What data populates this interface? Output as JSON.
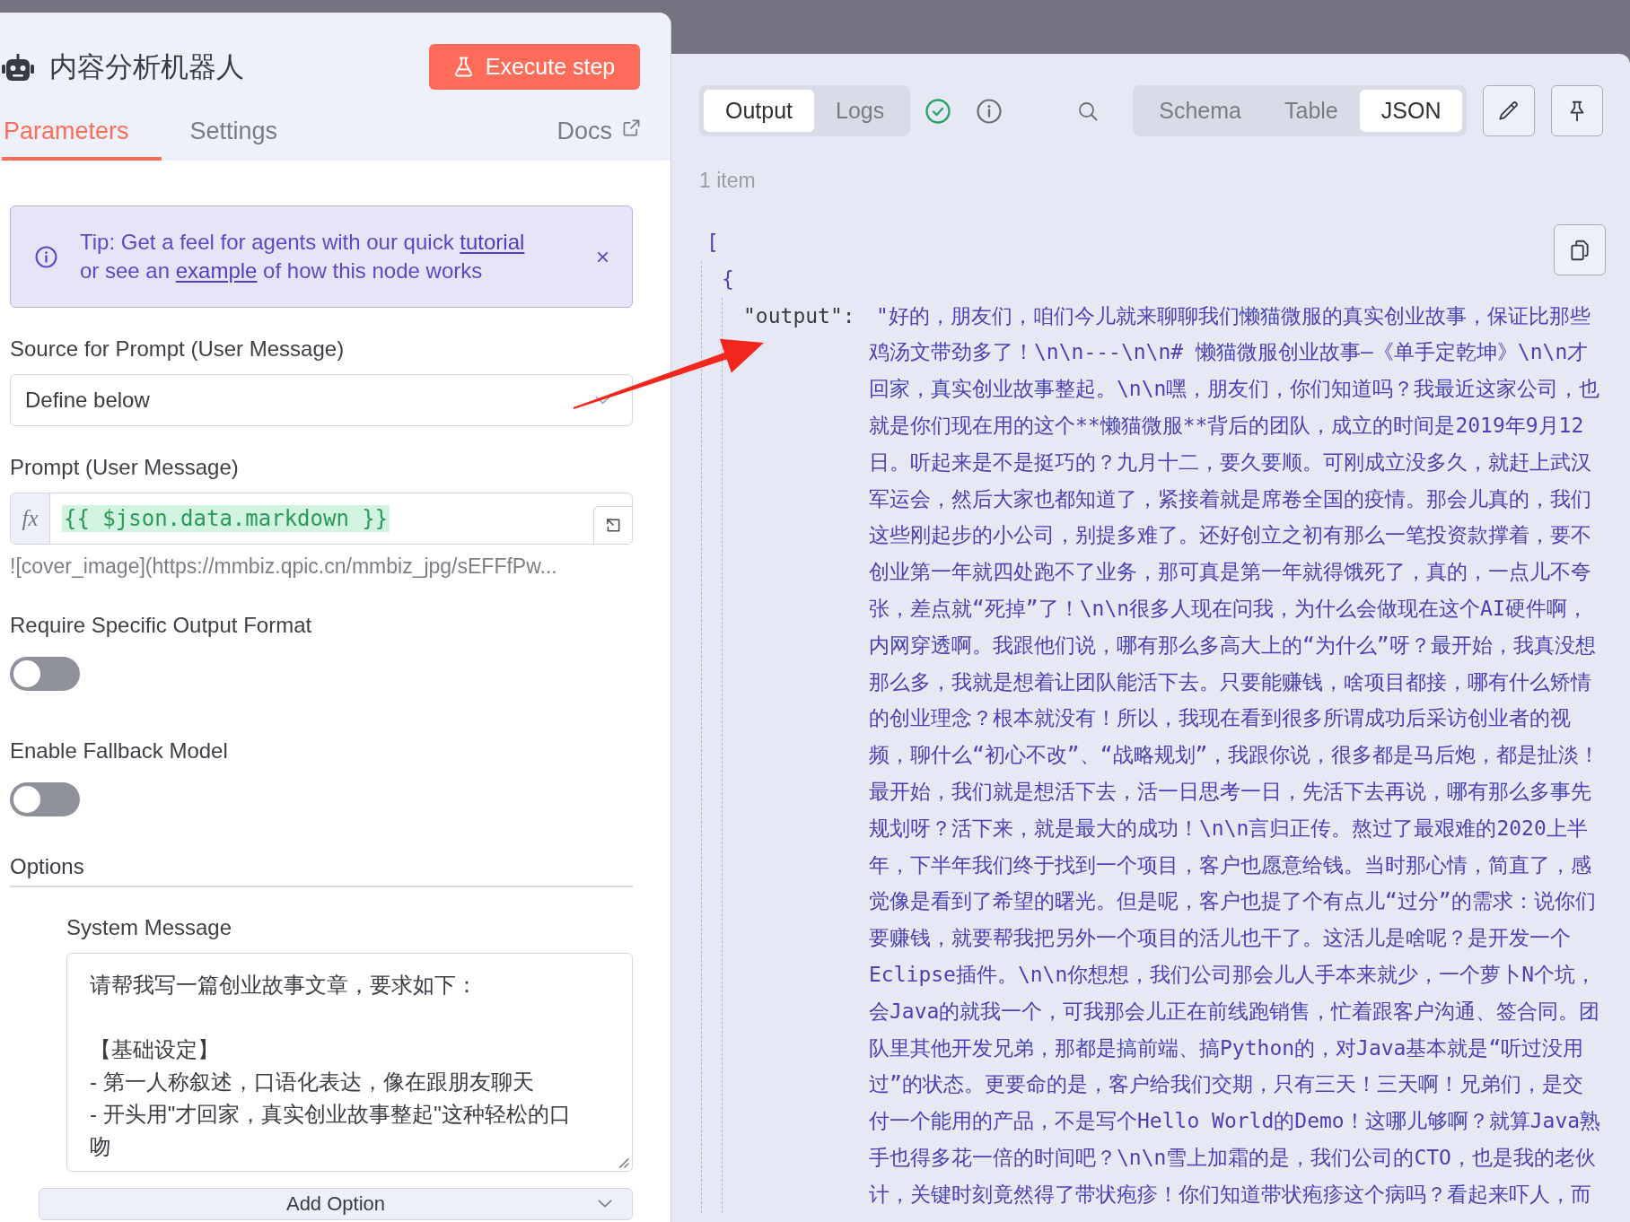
{
  "node_panel": {
    "title": "内容分析机器人",
    "execute_button": "Execute step",
    "tabs": [
      {
        "label": "Parameters",
        "selected": true
      },
      {
        "label": "Settings",
        "selected": false
      }
    ],
    "docs_link": "Docs",
    "tip": {
      "segments": [
        {
          "kind": "text",
          "text": "Tip: Get a feel for agents with our quick "
        },
        {
          "kind": "link",
          "text": "tutorial"
        },
        {
          "kind": "text",
          "text": " or see an "
        },
        {
          "kind": "link",
          "text": "example"
        },
        {
          "kind": "text",
          "text": " of how this node works"
        }
      ]
    },
    "source_field": {
      "label": "Source for Prompt (User Message)",
      "value": "Define below"
    },
    "prompt_field": {
      "label": "Prompt (User Message)",
      "mode_badge": "fx",
      "expression": "{{ $json.data.markdown }}",
      "preview": "![cover_image](https://mmbiz.qpic.cn/mmbiz_jpg/sEFFfPw..."
    },
    "toggles": [
      {
        "label": "Require Specific Output Format",
        "on": false
      },
      {
        "label": "Enable Fallback Model",
        "on": false
      }
    ],
    "options": {
      "title": "Options",
      "system_message": {
        "label": "System Message",
        "paragraphs": [
          [
            "请帮我写一篇创业故事文章，要求如下："
          ],
          [
            "【基础设定】",
            "- 第一人称叙述，口语化表达，像在跟朋友聊天",
            "- 开头用\"才回家，真实创业故事整起\"这种轻松的口吻"
          ]
        ]
      },
      "add_button": "Add Option"
    }
  },
  "output_panel": {
    "view_tabs": [
      {
        "label": "Output",
        "selected": true
      },
      {
        "label": "Logs",
        "selected": false
      }
    ],
    "run_success": true,
    "display_modes": [
      {
        "label": "Schema",
        "selected": false
      },
      {
        "label": "Table",
        "selected": false
      },
      {
        "label": "JSON",
        "selected": true
      }
    ],
    "item_count": "1 item",
    "json_view": {
      "open_bracket": "[",
      "open_brace": "{",
      "key": "\"output\":",
      "value_lines": [
        "\"好的，朋友们，咱们今儿就来聊聊我们懒猫微服的真实创业故事，保证比那些",
        "鸡汤文带劲多了！\\n\\n---\\n\\n# 懒猫微服创业故事—《单手定乾坤》\\n\\n才",
        "回家，真实创业故事整起。\\n\\n嘿，朋友们，你们知道吗？我最近这家公司，也",
        "就是你们现在用的这个**懒猫微服**背后的团队，成立的时间是2019年9月12",
        "日。听起来是不是挺巧的？九月十二，要久要顺。可刚成立没多久，就赶上武汉",
        "军运会，然后大家也都知道了，紧接着就是席卷全国的疫情。那会儿真的，我们",
        "这些刚起步的小公司，别提多难了。还好创立之初有那么一笔投资款撑着，要不",
        "创业第一年就四处跑不了业务，那可真是第一年就得饿死了，真的，一点儿不夸",
        "张，差点就“死掉”了！\\n\\n很多人现在问我，为什么会做现在这个AI硬件啊，",
        "内网穿透啊。我跟他们说，哪有那么多高大上的“为什么”呀？最开始，我真没想",
        "那么多，我就是想着让团队能活下去。只要能赚钱，啥项目都接，哪有什么矫情",
        "的创业理念？根本就没有！所以，我现在看到很多所谓成功后采访创业者的视",
        "频，聊什么“初心不改”、“战略规划”，我跟你说，很多都是马后炮，都是扯淡！",
        "最开始，我们就是想活下去，活一日思考一日，先活下去再说，哪有那么多事先",
        "规划呀？活下来，就是最大的成功！\\n\\n言归正传。熬过了最艰难的2020上半",
        "年，下半年我们终于找到一个项目，客户也愿意给钱。当时那心情，简直了，感",
        "觉像是看到了希望的曙光。但是呢，客户也提了个有点儿“过分”的需求：说你们",
        "要赚钱，就要帮我把另外一个项目的活儿也干了。这活儿是啥呢？是开发一个",
        "Eclipse插件。\\n\\n你想想，我们公司那会儿人手本来就少，一个萝卜N个坑，",
        "会Java的就我一个，可我那会儿正在前线跑销售，忙着跟客户沟通、签合同。团",
        "队里其他开发兄弟，那都是搞前端、搞Python的，对Java基本就是“听过没用",
        "过”的状态。更要命的是，客户给我们交期，只有三天！三天啊！兄弟们，是交",
        "付一个能用的产品，不是写个Hello World的Demo！这哪儿够啊？就算Java熟",
        "手也得多花一倍的时间吧？\\n\\n雪上加霜的是，我们公司的CTO，也是我的老伙",
        "计，关键时刻竟然得了带状疱疹！你们知道带状疱疹这个病吗？看起来吓人，而"
      ]
    }
  }
}
